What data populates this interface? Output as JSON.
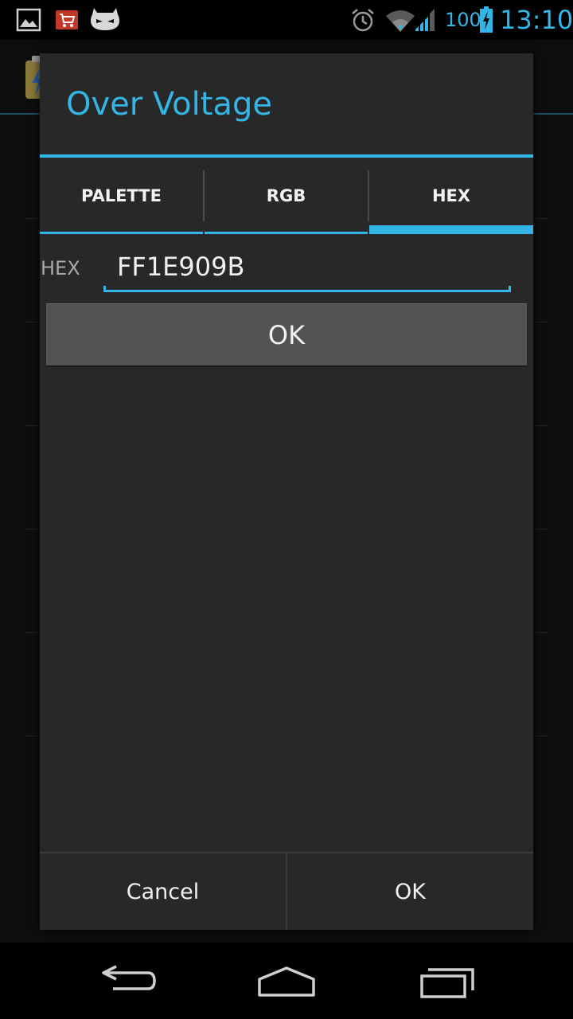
{
  "status_bar": {
    "battery_level": "100",
    "clock": "13:10",
    "icons": [
      "gallery-icon",
      "market-icon",
      "cyanogenmod-icon",
      "alarm-icon",
      "wifi-icon",
      "signal-icon",
      "battery-charging-icon"
    ],
    "accent_color": "#33b5e5"
  },
  "dialog": {
    "title": "Over Voltage",
    "tabs": [
      {
        "label": "PALETTE",
        "selected": false
      },
      {
        "label": "RGB",
        "selected": false
      },
      {
        "label": "HEX",
        "selected": true
      }
    ],
    "hex": {
      "label": "HEX",
      "value": "FF1E909B"
    },
    "inner_ok_label": "OK",
    "buttons": {
      "cancel_label": "Cancel",
      "ok_label": "OK"
    }
  },
  "nav_bar": {
    "icons": [
      "back-icon",
      "home-icon",
      "recent-apps-icon"
    ]
  },
  "colors": {
    "accent": "#33b5e5",
    "dialog_background": "#282828",
    "button_background": "#535353"
  }
}
